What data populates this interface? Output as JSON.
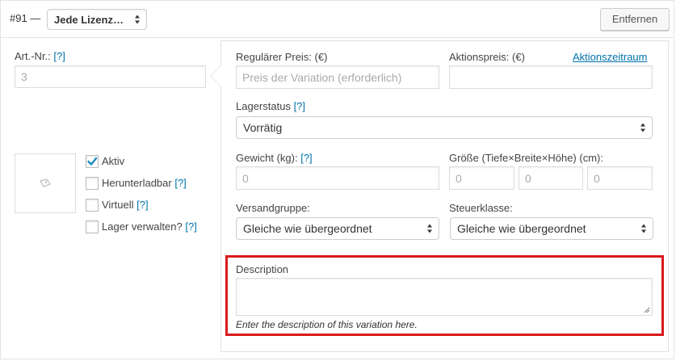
{
  "header": {
    "variation_number": "#91 —",
    "attribute_select_value": "Jede Lizenz…",
    "remove_button": "Entfernen"
  },
  "sku": {
    "label": "Art.-Nr.:",
    "help": "[?]",
    "placeholder": "3"
  },
  "checkboxes": [
    {
      "label": "Aktiv",
      "checked": true,
      "help": ""
    },
    {
      "label": "Herunterladbar",
      "checked": false,
      "help": "[?]"
    },
    {
      "label": "Virtuell",
      "checked": false,
      "help": "[?]"
    },
    {
      "label": "Lager verwalten?",
      "checked": false,
      "help": "[?]"
    }
  ],
  "pricing": {
    "regular_label": "Regulärer Preis: (€)",
    "regular_placeholder": "Preis der Variation (erforderlich)",
    "sale_label": "Aktionspreis: (€)",
    "sale_schedule_link": "Aktionszeitraum"
  },
  "stock": {
    "label": "Lagerstatus",
    "help": "[?]",
    "value": "Vorrätig"
  },
  "weight": {
    "label": "Gewicht (kg):",
    "help": "[?]",
    "placeholder": "0"
  },
  "dimensions": {
    "label": "Größe (Tiefe×Breite×Höhe) (cm):",
    "placeholders": [
      "0",
      "0",
      "0"
    ]
  },
  "shipping": {
    "label": "Versandgruppe:",
    "value": "Gleiche wie übergeordnet"
  },
  "tax": {
    "label": "Steuerklasse:",
    "value": "Gleiche wie übergeordnet"
  },
  "description": {
    "label": "Description",
    "hint": "Enter the description of this variation here."
  },
  "colors": {
    "highlight_border": "#d9191c",
    "link": "#0073aa",
    "check": "#1e8cbe"
  }
}
